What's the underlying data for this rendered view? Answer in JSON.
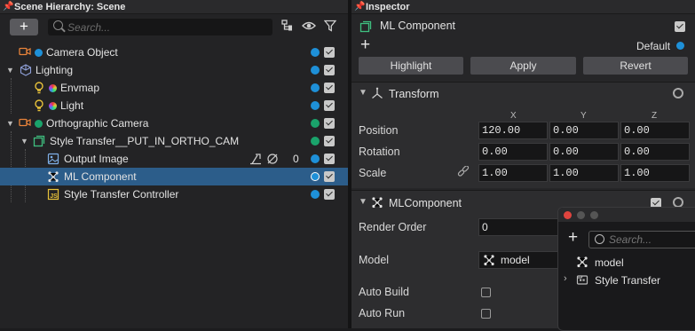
{
  "hierarchy": {
    "title": "Scene Hierarchy: Scene",
    "search_placeholder": "Search...",
    "add_label": "+",
    "items": [
      {
        "label": "Camera Object"
      },
      {
        "label": "Lighting"
      },
      {
        "label": "Envmap"
      },
      {
        "label": "Light"
      },
      {
        "label": "Orthographic Camera"
      },
      {
        "label": "Style Transfer__PUT_IN_ORTHO_CAM"
      },
      {
        "label": "Output Image",
        "count": "0"
      },
      {
        "label": "ML Component"
      },
      {
        "label": "Style Transfer Controller"
      }
    ]
  },
  "inspector": {
    "title": "Inspector",
    "object_name": "ML Component",
    "add_label": "+",
    "layer_label": "Default",
    "buttons": {
      "highlight": "Highlight",
      "apply": "Apply",
      "revert": "Revert"
    },
    "transform": {
      "title": "Transform",
      "axis_x": "X",
      "axis_y": "Y",
      "axis_z": "Z",
      "position_label": "Position",
      "rotation_label": "Rotation",
      "scale_label": "Scale",
      "position": [
        "120.00",
        "0.00",
        "0.00"
      ],
      "rotation": [
        "0.00",
        "0.00",
        "0.00"
      ],
      "scale": [
        "1.00",
        "1.00",
        "1.00"
      ]
    },
    "ml": {
      "title": "MLComponent",
      "render_order_label": "Render Order",
      "render_order": "0",
      "model_label": "Model",
      "model_value": "model",
      "auto_build_label": "Auto Build",
      "auto_run_label": "Auto Run"
    }
  },
  "popup": {
    "add_label": "+",
    "search_placeholder": "Search...",
    "items": [
      {
        "label": "model"
      },
      {
        "label": "Style Transfer"
      }
    ]
  },
  "colors": {
    "selection": "#2c5d8a",
    "dot_blue": "#1e90d8",
    "dot_green": "#1aa36b",
    "camera_icon": "#e8833a",
    "script_icon": "#e8c23a",
    "group_icon": "#3fbf7f"
  }
}
